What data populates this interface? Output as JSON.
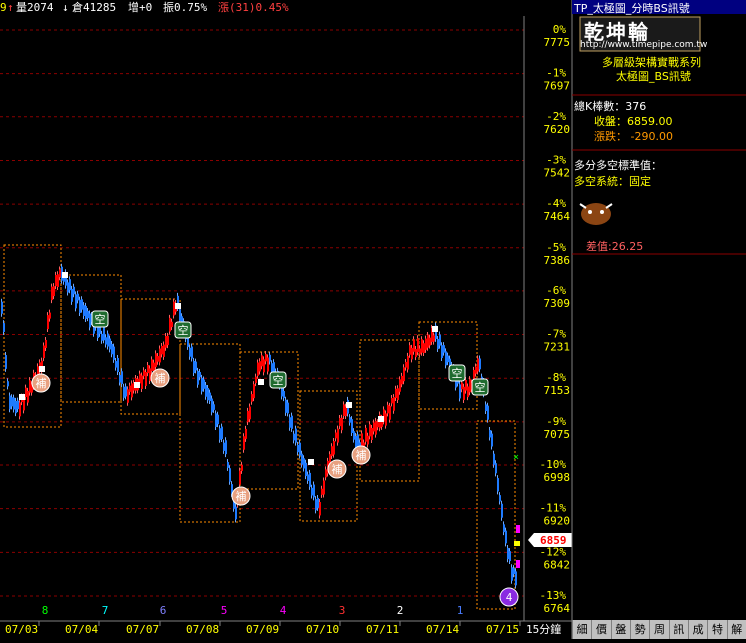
{
  "header": {
    "lead": "9",
    "up_arrow": "↑",
    "vol_label": "量2074",
    "down_arrow": "↓",
    "oi_label": "倉41285",
    "inc_label": "增+0",
    "amp_label": "振0.75%",
    "chg_label": "漲(31)0.45%"
  },
  "y_axis": {
    "pct_labels": [
      "0%",
      "-1%",
      "-2%",
      "-3%",
      "-4%",
      "-5%",
      "-6%",
      "-7%",
      "-8%",
      "-9%",
      "-10%",
      "-11%",
      "-12%",
      "-13%"
    ],
    "price_labels": [
      "7775",
      "7697",
      "7620",
      "7542",
      "7464",
      "7386",
      "7309",
      "7231",
      "7153",
      "7075",
      "6998",
      "6920",
      "6842",
      "6764"
    ],
    "current_price": "6859"
  },
  "x_axis": {
    "dates": [
      "07/03",
      "07/04",
      "07/07",
      "07/08",
      "07/09",
      "07/10",
      "07/11",
      "07/14",
      "07/15"
    ],
    "timeframe": "15分鐘",
    "count_labels": [
      {
        "text": "8",
        "color": "#00ff00"
      },
      {
        "text": "7",
        "color": "#00ffff"
      },
      {
        "text": "6",
        "color": "#8080ff"
      },
      {
        "text": "5",
        "color": "#ff00ff"
      },
      {
        "text": "4",
        "color": "#ff00ff"
      },
      {
        "text": "3",
        "color": "#ff3030"
      },
      {
        "text": "2",
        "color": "#ffffff"
      },
      {
        "text": "1",
        "color": "#4a7dff"
      }
    ]
  },
  "markers": {
    "long": "補",
    "short": "空",
    "count_badge": "4"
  },
  "side_panel": {
    "title": "TP_太極圖_分時BS訊號",
    "logo_text": "乾坤輪",
    "logo_url": "http://www.timepipe.com.tw",
    "subtitle1": "多層級架構實戰系列",
    "subtitle2": "太極圖_BS訊號",
    "bars_label": "總K棒數：376",
    "close_label": "收盤：6859.00",
    "change_label": "漲跌： -290.00",
    "std_label": "多分多空標準值：",
    "system_label": "多空系統：固定",
    "bull_icon": "bull-icon",
    "diff_label": "差值:26.25"
  },
  "tabs": [
    "細",
    "價",
    "盤",
    "勢",
    "周",
    "訊",
    "成",
    "特",
    "解"
  ],
  "colors": {
    "up": "#ff0000",
    "down": "#1e7bff",
    "box": "#ff8c00",
    "grid": "#8b0000",
    "axis_text": "#ffff00"
  }
}
